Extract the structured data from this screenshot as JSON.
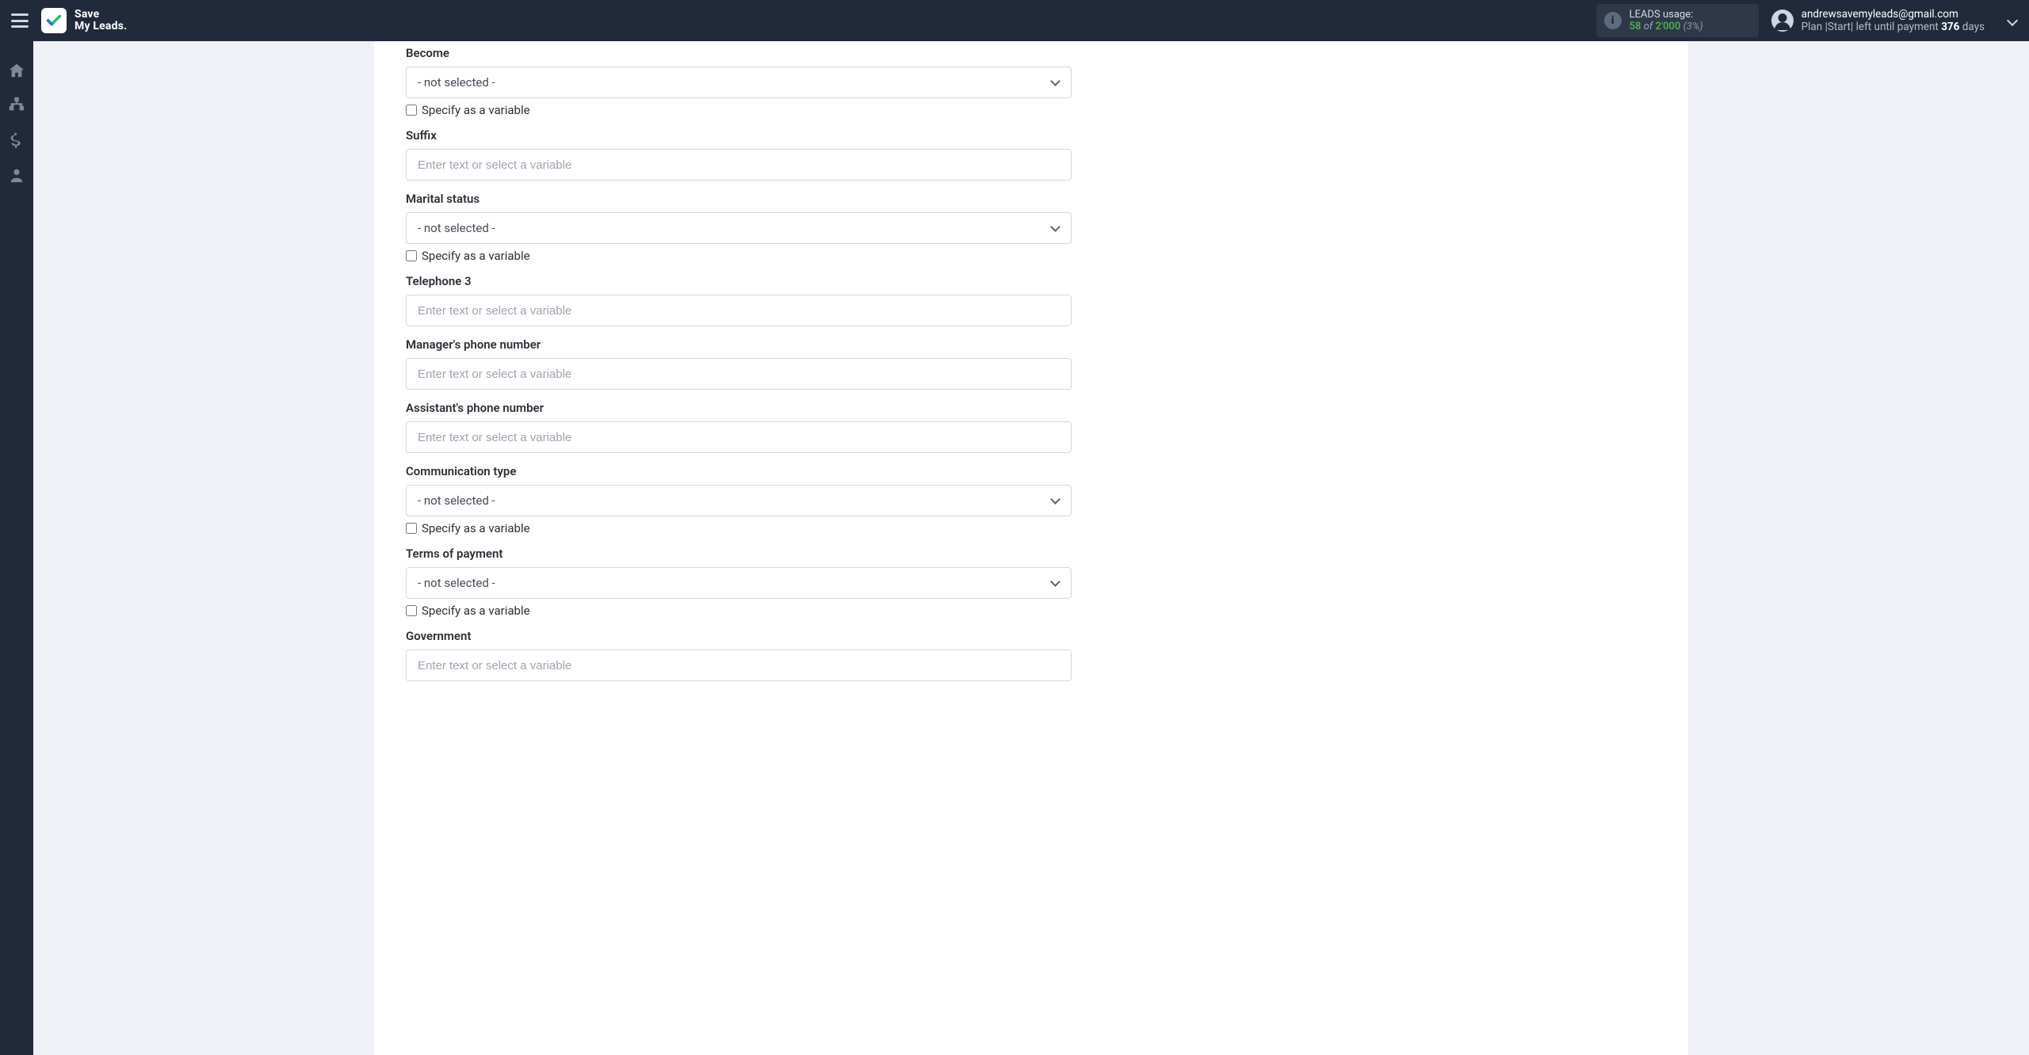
{
  "header": {
    "logo_line1": "Save",
    "logo_line2": "My Leads.",
    "usage": {
      "title": "LEADS usage:",
      "used": "58",
      "of": "of",
      "total": "2'000",
      "pct": "(3%)"
    },
    "user": {
      "email": "andrewsavemyleads@gmail.com",
      "plan_prefix": "Plan |",
      "plan_name": "Start",
      "plan_suffix": "| left until payment ",
      "days": "376",
      "days_suffix": " days"
    }
  },
  "shared": {
    "not_selected": "- not selected -",
    "placeholder": "Enter text or select a variable",
    "specify_variable": "Specify as a variable"
  },
  "fields": {
    "become": {
      "label": "Become"
    },
    "suffix": {
      "label": "Suffix"
    },
    "marital": {
      "label": "Marital status"
    },
    "tel3": {
      "label": "Telephone 3"
    },
    "manager_phone": {
      "label": "Manager's phone number"
    },
    "assist_phone": {
      "label": "Assistant's phone number"
    },
    "comm_type": {
      "label": "Communication type"
    },
    "terms": {
      "label": "Terms of payment"
    },
    "government": {
      "label": "Government"
    }
  }
}
